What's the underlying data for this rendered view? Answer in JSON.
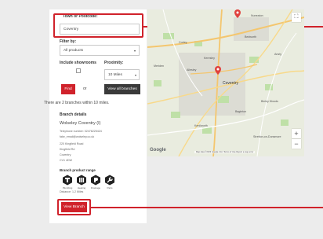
{
  "search": {
    "town_label": "Town or Postcode:",
    "town_value": "Coventry"
  },
  "filter": {
    "label": "Filter by:",
    "selected": "All products"
  },
  "showrooms": {
    "label": "Include showrooms"
  },
  "proximity": {
    "label": "Proximity:",
    "selected": "10 Miles"
  },
  "actions": {
    "find_label": "Find",
    "or_text": "or",
    "view_all_label": "View all branches"
  },
  "results": {
    "summary": "There are 2 branches within 10 miles."
  },
  "branch": {
    "heading": "Branch details",
    "name": "Wolseley Coventry (I)",
    "phone": "Telephone number: 02476225424",
    "email": "fake_email@wolseley.co.uk",
    "address": [
      "220 Kingfield Road",
      "Kingfield Rd",
      "Coventry",
      "CV1 4DW"
    ],
    "range_heading": "Branch product range",
    "categories": [
      "Plumbing",
      "Heating",
      "Drainage",
      "Parts"
    ],
    "distance": "Distance: 1.2 Miles",
    "view_label": "View Branch"
  },
  "map": {
    "labels": [
      "Bedworth",
      "Nuneaton",
      "Coventry",
      "Binley Woods",
      "Kenilworth",
      "Baginton",
      "Allesley",
      "Ansty",
      "Keresley",
      "Corley",
      "Meriden",
      "Stretton-on-Dunsmore"
    ],
    "google": "Google",
    "footer": "Map data ©2023 Google  2 km  Terms of Use  Report a map error"
  },
  "colors": {
    "accent": "#d0222b",
    "dark_button": "#3a3a3a",
    "marker": "#e0413d"
  }
}
